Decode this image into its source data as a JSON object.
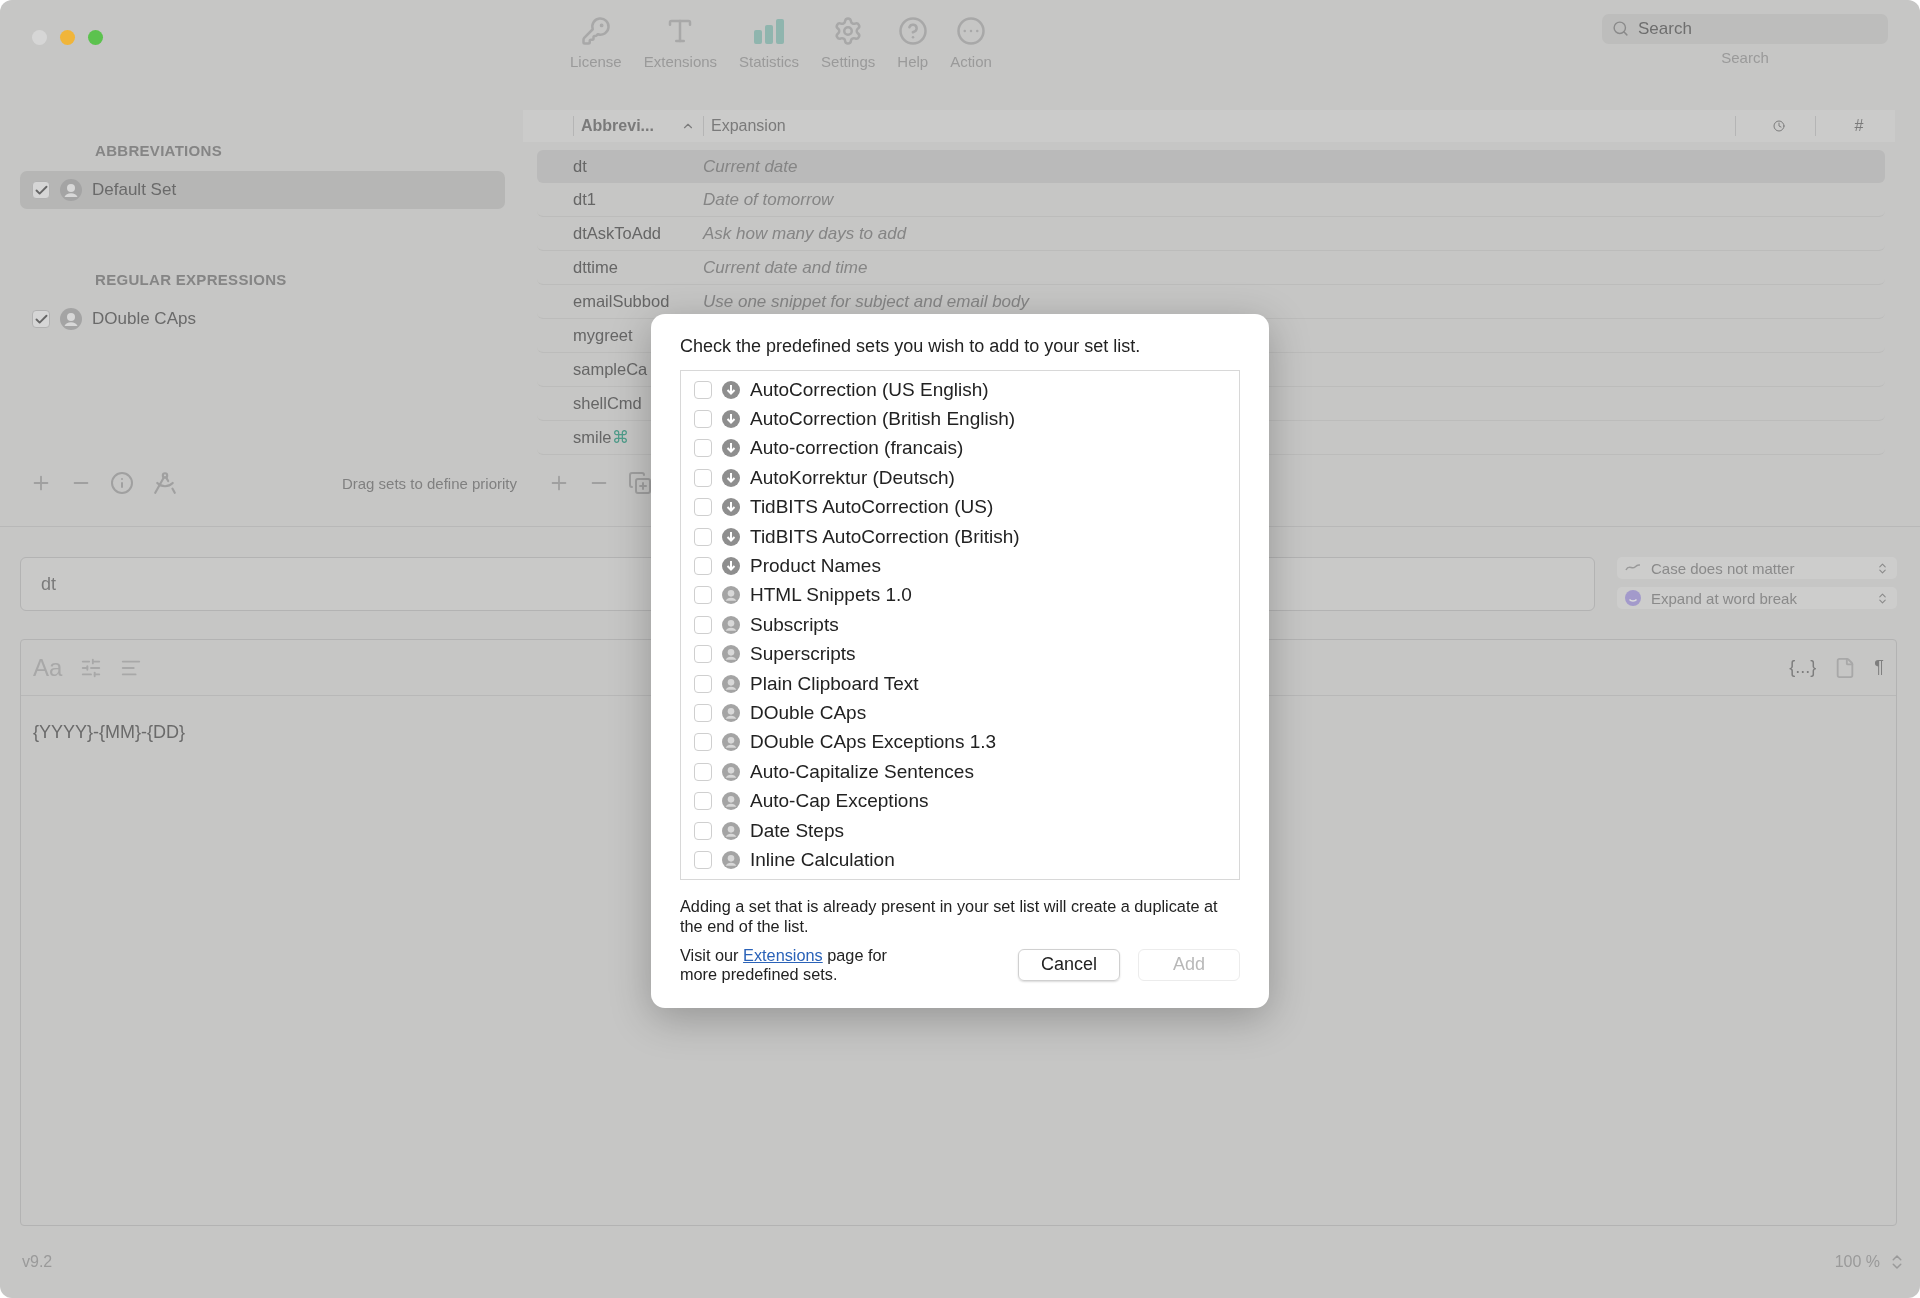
{
  "window": {
    "traffic_lights": [
      {
        "color": "#d6d6d6"
      },
      {
        "color": "#f0b53a"
      },
      {
        "color": "#5cc24e"
      }
    ]
  },
  "toolbar": {
    "items": [
      {
        "label": "License",
        "selected": false
      },
      {
        "label": "Extensions",
        "selected": false
      },
      {
        "label": "Statistics",
        "selected": true
      },
      {
        "label": "Settings",
        "selected": false
      },
      {
        "label": "Help",
        "selected": false
      },
      {
        "label": "Action",
        "selected": false
      }
    ],
    "search": {
      "placeholder": "Search",
      "label": "Search"
    }
  },
  "sidebar": {
    "sections": [
      {
        "title": "ABBREVIATIONS",
        "items": [
          {
            "name": "Default Set",
            "checked": true,
            "selected": true
          }
        ]
      },
      {
        "title": "REGULAR EXPRESSIONS",
        "items": [
          {
            "name": "DOuble CAps",
            "checked": true,
            "selected": false
          }
        ]
      }
    ],
    "hint": "Drag sets to define priority"
  },
  "table": {
    "columns": [
      {
        "label": "Abbrevi..."
      },
      {
        "label": "Expansion"
      },
      {
        "label": "#"
      }
    ],
    "rows": [
      {
        "abbreviation": "dt",
        "expansion": "Current date",
        "selected": true
      },
      {
        "abbreviation": "dt1",
        "expansion": "Date of tomorrow",
        "selected": false
      },
      {
        "abbreviation": "dtAskToAdd",
        "expansion": "Ask how many days to add",
        "selected": false
      },
      {
        "abbreviation": "dttime",
        "expansion": "Current date and time",
        "selected": false
      },
      {
        "abbreviation": "emailSubbod",
        "expansion": "Use one snippet for subject and email body",
        "selected": false
      },
      {
        "abbreviation": "mygreet",
        "selected": false
      },
      {
        "abbreviation": "sampleCa",
        "selected": false
      },
      {
        "abbreviation": "shellCmd",
        "selected": false
      },
      {
        "abbreviation": "smile",
        "suffix": "⌘",
        "selected": false
      }
    ]
  },
  "abbreviation_field": {
    "value": "dt"
  },
  "options": [
    {
      "label": "Case does not matter",
      "kind": "case"
    },
    {
      "label": "Expand at word break",
      "kind": "expand"
    }
  ],
  "editor": {
    "font_button": "Aa",
    "placeholder_button": "{...}",
    "paragraph_button": "¶",
    "content": "{YYYY}-{MM}-{DD}"
  },
  "status_bar": {
    "version": "v9.2",
    "zoom": "100 %"
  },
  "dialog": {
    "title": "Check the predefined sets you wish to add to your set list.",
    "sets": [
      {
        "name": "AutoCorrection (US English)",
        "checked": false,
        "kind": "download"
      },
      {
        "name": "AutoCorrection (British English)",
        "checked": false,
        "kind": "download"
      },
      {
        "name": "Auto-correction (francais)",
        "checked": false,
        "kind": "download"
      },
      {
        "name": "AutoKorrektur (Deutsch)",
        "checked": false,
        "kind": "download"
      },
      {
        "name": "TidBITS AutoCorrection (US)",
        "checked": false,
        "kind": "download"
      },
      {
        "name": "TidBITS AutoCorrection (British)",
        "checked": false,
        "kind": "download"
      },
      {
        "name": "Product Names",
        "checked": false,
        "kind": "download"
      },
      {
        "name": "HTML Snippets 1.0",
        "checked": false,
        "kind": "user"
      },
      {
        "name": "Subscripts",
        "checked": false,
        "kind": "user"
      },
      {
        "name": "Superscripts",
        "checked": false,
        "kind": "user"
      },
      {
        "name": "Plain Clipboard Text",
        "checked": false,
        "kind": "user"
      },
      {
        "name": "DOuble CAps",
        "checked": false,
        "kind": "user"
      },
      {
        "name": "DOuble CAps Exceptions 1.3",
        "checked": false,
        "kind": "user"
      },
      {
        "name": "Auto-Capitalize Sentences",
        "checked": false,
        "kind": "user"
      },
      {
        "name": "Auto-Cap Exceptions",
        "checked": false,
        "kind": "user"
      },
      {
        "name": "Date Steps",
        "checked": false,
        "kind": "user"
      },
      {
        "name": "Inline Calculation",
        "checked": false,
        "kind": "user"
      }
    ],
    "note": "Adding a set that is already present in your set list will create a duplicate at the end of the list.",
    "visit": {
      "prefix": "Visit our",
      "link": "Extensions",
      "suffix": "page for more predefined sets."
    },
    "buttons": [
      {
        "label": "Cancel",
        "disabled": false
      },
      {
        "label": "Add",
        "disabled": true
      }
    ]
  }
}
